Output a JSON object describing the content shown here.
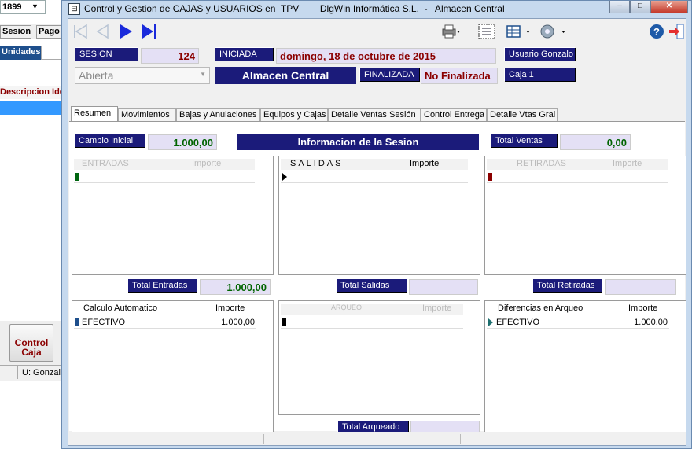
{
  "background_app": {
    "combo_value": "1899",
    "tabs": [
      "Sesion",
      "Pago"
    ],
    "units_label": "Unidades",
    "desc_header": "Descripcion Ide",
    "control_caja_label": "Control Caja",
    "status_user": "U: Gonzal"
  },
  "window": {
    "title": "Control y Gestion de CAJAS y USUARIOS en  TPV        DlgWin Informática S.L.  -   Almacen Central",
    "minimize_glyph": "–",
    "maximize_glyph": "□",
    "close_glyph": "✕"
  },
  "session": {
    "sesion_label": "SESION",
    "sesion_value": "124",
    "iniciada_label": "INICIADA",
    "iniciada_value": "domingo, 18 de octubre de 2015",
    "usuario": "Usuario Gonzalo",
    "estado": "Abierta",
    "almacen": "Almacen Central",
    "finalizada_label": "FINALIZADA",
    "finalizada_value": "No Finalizada",
    "caja": "Caja 1"
  },
  "tabs": [
    "Resumen",
    "Movimientos",
    "Bajas y Anulaciones",
    "Equipos y Cajas",
    "Detalle Ventas Sesión",
    "Control Entrega",
    "Detalle Vtas Gral"
  ],
  "resumen": {
    "cambio_inicial_label": "Cambio Inicial",
    "cambio_inicial_value": "1.000,00",
    "info_title": "Informacion de la Sesion",
    "total_ventas_label": "Total Ventas",
    "total_ventas_value": "0,00",
    "entradas_header": [
      "ENTRADAS",
      "Importe"
    ],
    "salidas_header": [
      "SALIDAS",
      "Importe"
    ],
    "retiradas_header": [
      "RETIRADAS",
      "Importe"
    ],
    "total_entradas_label": "Total Entradas",
    "total_entradas_value": "1.000,00",
    "total_salidas_label": "Total Salidas",
    "total_salidas_value": "",
    "total_retiradas_label": "Total Retiradas",
    "total_retiradas_value": "",
    "calculo_header": [
      "Calculo Automatico",
      "Importe"
    ],
    "calculo_row": [
      "EFECTIVO",
      "1.000,00"
    ],
    "arqueo_header": [
      "ARQUEO",
      "Importe"
    ],
    "diferencias_header": [
      "Diferencias en Arqueo",
      "Importe"
    ],
    "diferencias_row": [
      "EFECTIVO",
      "1.000,00"
    ],
    "total_arqueado_label": "Total Arqueado",
    "total_arqueado_value": ""
  },
  "colors": {
    "label_bg": "#1b1b7a",
    "value_bg": "#e4e0f5",
    "accent_red": "#8b0000",
    "value_green": "#006400"
  }
}
